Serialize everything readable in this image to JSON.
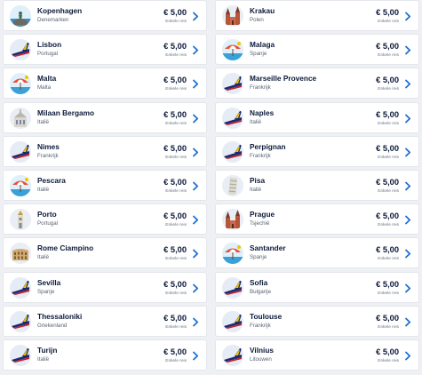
{
  "destinations": [
    {
      "city": "Kopenhagen",
      "country": "Denemarken",
      "price": "€ 5,00",
      "note": "Enkele reis",
      "icon": "little-mermaid-icon"
    },
    {
      "city": "Krakau",
      "country": "Polen",
      "price": "€ 5,00",
      "note": "Enkele reis",
      "icon": "church-icon"
    },
    {
      "city": "Lisbon",
      "country": "Portugal",
      "price": "€ 5,00",
      "note": "Enkele reis",
      "icon": "plane-tail-icon"
    },
    {
      "city": "Malaga",
      "country": "Spanje",
      "price": "€ 5,00",
      "note": "Enkele reis",
      "icon": "beach-umbrella-icon"
    },
    {
      "city": "Malta",
      "country": "Malta",
      "price": "€ 5,00",
      "note": "Enkele reis",
      "icon": "beach-umbrella-icon"
    },
    {
      "city": "Marseille Provence",
      "country": "Frankrijk",
      "price": "€ 5,00",
      "note": "Enkele reis",
      "icon": "plane-tail-icon"
    },
    {
      "city": "Milaan Bergamo",
      "country": "Italië",
      "price": "€ 5,00",
      "note": "Enkele reis",
      "icon": "cathedral-icon"
    },
    {
      "city": "Naples",
      "country": "Italië",
      "price": "€ 5,00",
      "note": "Enkele reis",
      "icon": "plane-tail-icon"
    },
    {
      "city": "Nimes",
      "country": "Frankrijk",
      "price": "€ 5,00",
      "note": "Enkele reis",
      "icon": "plane-tail-icon"
    },
    {
      "city": "Perpignan",
      "country": "Frankrijk",
      "price": "€ 5,00",
      "note": "Enkele reis",
      "icon": "plane-tail-icon"
    },
    {
      "city": "Pescara",
      "country": "Italië",
      "price": "€ 5,00",
      "note": "Enkele reis",
      "icon": "beach-umbrella-icon"
    },
    {
      "city": "Pisa",
      "country": "Italië",
      "price": "€ 5,00",
      "note": "Enkele reis",
      "icon": "leaning-tower-icon"
    },
    {
      "city": "Porto",
      "country": "Portugal",
      "price": "€ 5,00",
      "note": "Enkele reis",
      "icon": "church-tower-icon"
    },
    {
      "city": "Prague",
      "country": "Tsjechië",
      "price": "€ 5,00",
      "note": "Enkele reis",
      "icon": "church-icon"
    },
    {
      "city": "Rome Ciampino",
      "country": "Italië",
      "price": "€ 5,00",
      "note": "Enkele reis",
      "icon": "colosseum-icon"
    },
    {
      "city": "Santander",
      "country": "Spanje",
      "price": "€ 5,00",
      "note": "Enkele reis",
      "icon": "beach-umbrella-icon"
    },
    {
      "city": "Sevilla",
      "country": "Spanje",
      "price": "€ 5,00",
      "note": "Enkele reis",
      "icon": "plane-tail-icon"
    },
    {
      "city": "Sofia",
      "country": "Bulgarije",
      "price": "€ 5,00",
      "note": "Enkele reis",
      "icon": "plane-tail-icon"
    },
    {
      "city": "Thessaloniki",
      "country": "Griekenland",
      "price": "€ 5,00",
      "note": "Enkele reis",
      "icon": "plane-tail-icon"
    },
    {
      "city": "Toulouse",
      "country": "Frankrijk",
      "price": "€ 5,00",
      "note": "Enkele reis",
      "icon": "plane-tail-icon"
    },
    {
      "city": "Turijn",
      "country": "Italië",
      "price": "€ 5,00",
      "note": "Enkele reis",
      "icon": "plane-tail-icon"
    },
    {
      "city": "Vilnius",
      "country": "Litouwen",
      "price": "€ 5,00",
      "note": "Enkele reis",
      "icon": "plane-tail-icon"
    }
  ],
  "colors": {
    "navy": "#0c1a3a",
    "accent_blue": "#1f6fd1",
    "card_bg": "#ffffff",
    "page_bg": "#eef0f3"
  }
}
